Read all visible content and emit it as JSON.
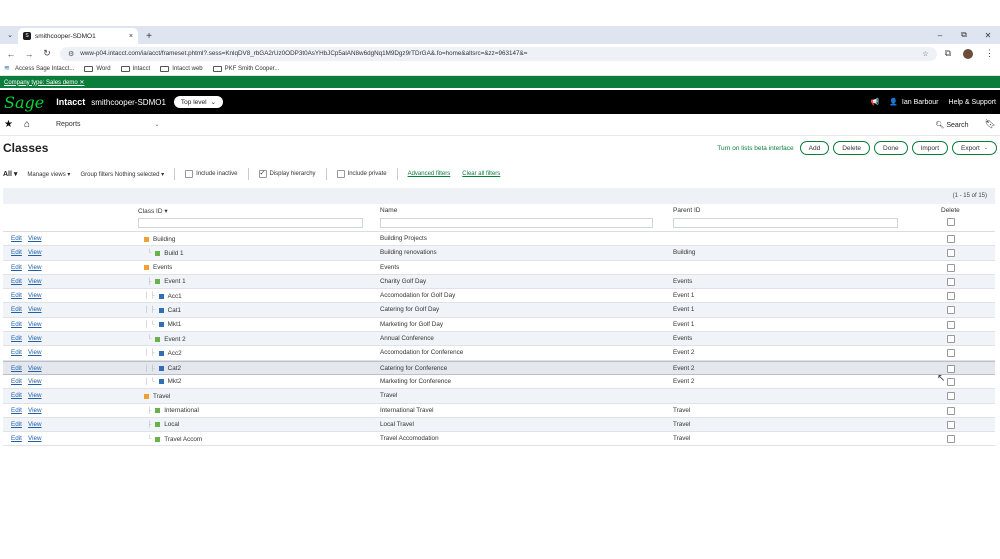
{
  "browser": {
    "tab_title": "smithcooper-SDMO1",
    "tab_favicon": "S",
    "tab_close": "×",
    "new_tab": "+",
    "window_controls": [
      "–",
      "⧉",
      "✕"
    ],
    "url": "www-p04.intacct.com/ia/acct/frameset.phtml?.sess=KnlqDV8_rbGA2rUz0ODP3t0AsYHbJCp5alAN8w6dgNq1M9Dgz9rTDrGA&.fo=home&altsrc=&zz=963147&=",
    "bookmarks": [
      {
        "label": "Access Sage Intacct...",
        "icon": "sage-icon"
      },
      {
        "label": "Word",
        "icon": "folder-icon"
      },
      {
        "label": "Intacct",
        "icon": "folder-icon"
      },
      {
        "label": "Intacct web",
        "icon": "folder-icon"
      },
      {
        "label": "PKF Smith Cooper...",
        "icon": "folder-icon"
      }
    ]
  },
  "company_bar": {
    "text": "Company type: Sales demo ✕"
  },
  "app_header": {
    "logo": "Sage",
    "app_name": "Intacct",
    "company": "smithcooper-SDMO1",
    "level": "Top level",
    "user": "Ian Barbour",
    "help": "Help & Support"
  },
  "menu": {
    "reports": "Reports",
    "search": "Search"
  },
  "page": {
    "title": "Classes",
    "beta_link": "Turn on lists beta interface",
    "buttons": {
      "add": "Add",
      "delete": "Delete",
      "done": "Done",
      "import": "Import",
      "export": "Export"
    }
  },
  "filters": {
    "all": "All ▾",
    "manage_views": "Manage views ▾",
    "group_filters": "Group filters  Nothing selected ▾",
    "include_inactive": "Include inactive",
    "display_hierarchy": "Display hierarchy",
    "include_private": "Include private",
    "advanced_filters": "Advanced filters",
    "clear_all_filters": "Clear all filters"
  },
  "grid": {
    "count": "(1 - 15 of 15)",
    "columns": {
      "class_id": "Class ID ▾",
      "name": "Name",
      "parent_id": "Parent ID",
      "delete": "Delete"
    },
    "action_edit": "Edit",
    "action_view": "View",
    "rows": [
      {
        "id": "Building",
        "name": "Building Projects",
        "parent": "",
        "level": 0,
        "color": "#f0a030",
        "guide": ""
      },
      {
        "id": "Build 1",
        "name": "Building renovations",
        "parent": "Building",
        "level": 1,
        "color": "#6ab04c",
        "guide": "└"
      },
      {
        "id": "Events",
        "name": "Events",
        "parent": "",
        "level": 0,
        "color": "#f0a030",
        "guide": ""
      },
      {
        "id": "Event 1",
        "name": "Charity Golf Day",
        "parent": "Events",
        "level": 1,
        "color": "#6ab04c",
        "guide": "├"
      },
      {
        "id": "Acc1",
        "name": "Accomodation for Golf Day",
        "parent": "Event 1",
        "level": 2,
        "color": "#2f6fb5",
        "guide": "│ ├"
      },
      {
        "id": "Cat1",
        "name": "Catering for Golf Day",
        "parent": "Event 1",
        "level": 2,
        "color": "#2f6fb5",
        "guide": "│ ├"
      },
      {
        "id": "Mkt1",
        "name": "Marketing for Golf Day",
        "parent": "Event 1",
        "level": 2,
        "color": "#2f6fb5",
        "guide": "│ └"
      },
      {
        "id": "Event 2",
        "name": "Annual Conference",
        "parent": "Events",
        "level": 1,
        "color": "#6ab04c",
        "guide": "└"
      },
      {
        "id": "Acc2",
        "name": "Accomodation for Conference",
        "parent": "Event 2",
        "level": 2,
        "color": "#2f6fb5",
        "guide": "│ ├"
      },
      {
        "id": "Cat2",
        "name": "Catering for Conference",
        "parent": "Event 2",
        "level": 2,
        "color": "#2f6fb5",
        "guide": "│ ├"
      },
      {
        "id": "Mkt2",
        "name": "Marketing for Conference",
        "parent": "Event 2",
        "level": 2,
        "color": "#2f6fb5",
        "guide": "│ └"
      },
      {
        "id": "Travel",
        "name": "Travel",
        "parent": "",
        "level": 0,
        "color": "#f0a030",
        "guide": ""
      },
      {
        "id": "International",
        "name": "International Travel",
        "parent": "Travel",
        "level": 1,
        "color": "#6ab04c",
        "guide": "├"
      },
      {
        "id": "Local",
        "name": "Local Travel",
        "parent": "Travel",
        "level": 1,
        "color": "#6ab04c",
        "guide": "├"
      },
      {
        "id": "Travel Accom",
        "name": "Travel Accomodation",
        "parent": "Travel",
        "level": 1,
        "color": "#6ab04c",
        "guide": "└"
      }
    ],
    "selected_row": "Cat2"
  }
}
